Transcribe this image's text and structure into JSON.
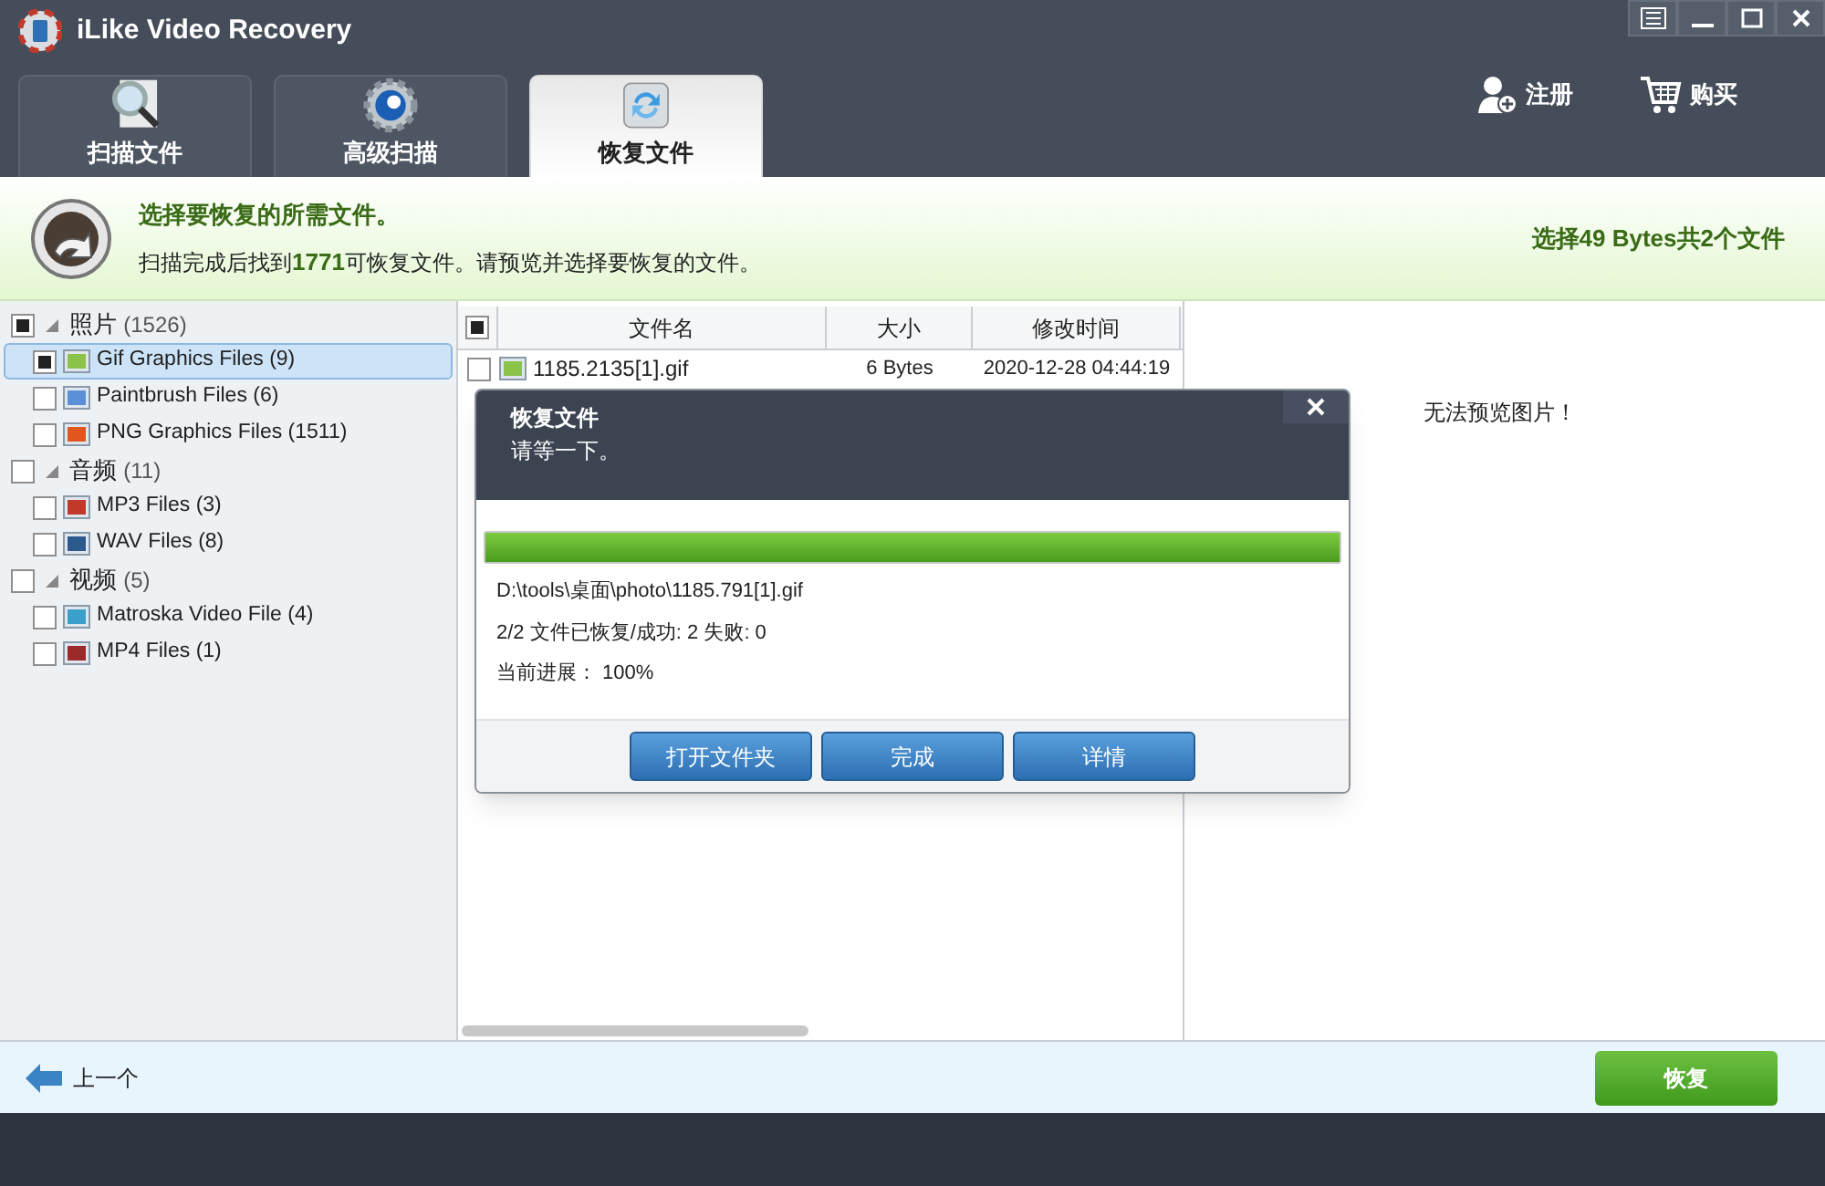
{
  "window": {
    "title": "iLike Video Recovery",
    "controls": [
      {
        "kind": "menu"
      },
      {
        "kind": "minimize"
      },
      {
        "kind": "maximize"
      },
      {
        "kind": "close"
      }
    ]
  },
  "tabs": [
    {
      "label": "扫描文件",
      "kind": "scan",
      "selected": false
    },
    {
      "label": "高级扫描",
      "kind": "advanced",
      "selected": false
    },
    {
      "label": "恢复文件",
      "kind": "recover",
      "selected": true
    }
  ],
  "actions": [
    {
      "label": "注册",
      "kind": "register"
    },
    {
      "label": "购买",
      "kind": "buy"
    }
  ],
  "header": {
    "title": "选择要恢复的所需文件。",
    "message": "扫描完成后找到**1771**可恢复文件。请预览并选择要恢复的文件。",
    "summary": "选择49 Bytes共2个文件"
  },
  "tree": [
    {
      "label": "照片",
      "count": "(1526)",
      "checked": true,
      "expanded": true,
      "children": [
        {
          "label": "Gif Graphics Files (9)",
          "checked": true,
          "selected": true,
          "kind": "gif"
        },
        {
          "label": "Paintbrush Files (6)",
          "checked": false,
          "selected": false,
          "kind": "paint"
        },
        {
          "label": "PNG Graphics Files (1511)",
          "checked": false,
          "selected": false,
          "kind": "png"
        }
      ]
    },
    {
      "label": "音频",
      "count": "(11)",
      "checked": false,
      "expanded": true,
      "children": [
        {
          "label": "MP3 Files (3)",
          "checked": false,
          "selected": false,
          "kind": "mp3"
        },
        {
          "label": "WAV Files (8)",
          "checked": false,
          "selected": false,
          "kind": "wav"
        }
      ]
    },
    {
      "label": "视频",
      "count": "(5)",
      "checked": false,
      "expanded": true,
      "children": [
        {
          "label": "Matroska Video File (4)",
          "checked": false,
          "selected": false,
          "kind": "mkv"
        },
        {
          "label": "MP4 Files (1)",
          "checked": false,
          "selected": false,
          "kind": "mp4"
        }
      ]
    }
  ],
  "table": {
    "all_checked": true,
    "columns": [
      "文件名",
      "大小",
      "修改时间"
    ],
    "rows": [
      {
        "name": "1185.2135[1].gif",
        "size": "6 Bytes",
        "time": "2020-12-28 04:44:19",
        "checked": false
      }
    ]
  },
  "preview": {
    "message": "无法预览图片！"
  },
  "dialog": {
    "title": "恢复文件",
    "subtitle": "请等一下。",
    "progress": {
      "level": 1
    },
    "lines": [
      "D:\\tools\\桌面\\photo\\1185.791[1].gif",
      "2/2 文件已恢复/成功: 2 失败: 0",
      "当前进展： 100%"
    ],
    "buttons": [
      "打开文件夹",
      "完成",
      "详情"
    ]
  },
  "footer": {
    "back": "上一个",
    "recover": "恢复"
  }
}
